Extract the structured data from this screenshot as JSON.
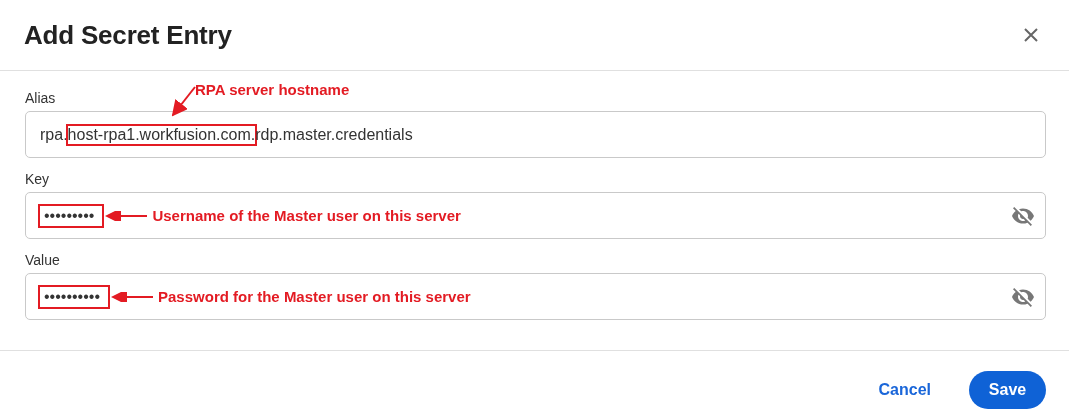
{
  "dialog": {
    "title": "Add Secret Entry"
  },
  "fields": [
    {
      "label": "Alias",
      "masked": false,
      "annotation": {
        "kind": "above",
        "text": "RPA server hostname"
      },
      "value_parts": [
        {
          "text": "rpa.",
          "highlighted": false
        },
        {
          "text": "host-rpa1.workfusion.com.",
          "highlighted": true
        },
        {
          "text": "rdp.master.credentials",
          "highlighted": false
        }
      ]
    },
    {
      "label": "Key",
      "masked": true,
      "annotation": {
        "kind": "inline",
        "text": "Username of the Master user on this server"
      },
      "value_parts": [
        {
          "text": "•••••••••",
          "highlighted": true
        }
      ]
    },
    {
      "label": "Value",
      "masked": true,
      "annotation": {
        "kind": "inline",
        "text": "Password for the Master user on this server"
      },
      "value_parts": [
        {
          "text": "••••••••••",
          "highlighted": true
        }
      ]
    }
  ],
  "buttons": [
    {
      "label": "Cancel",
      "kind": "text"
    },
    {
      "label": "Save",
      "kind": "primary"
    }
  ]
}
